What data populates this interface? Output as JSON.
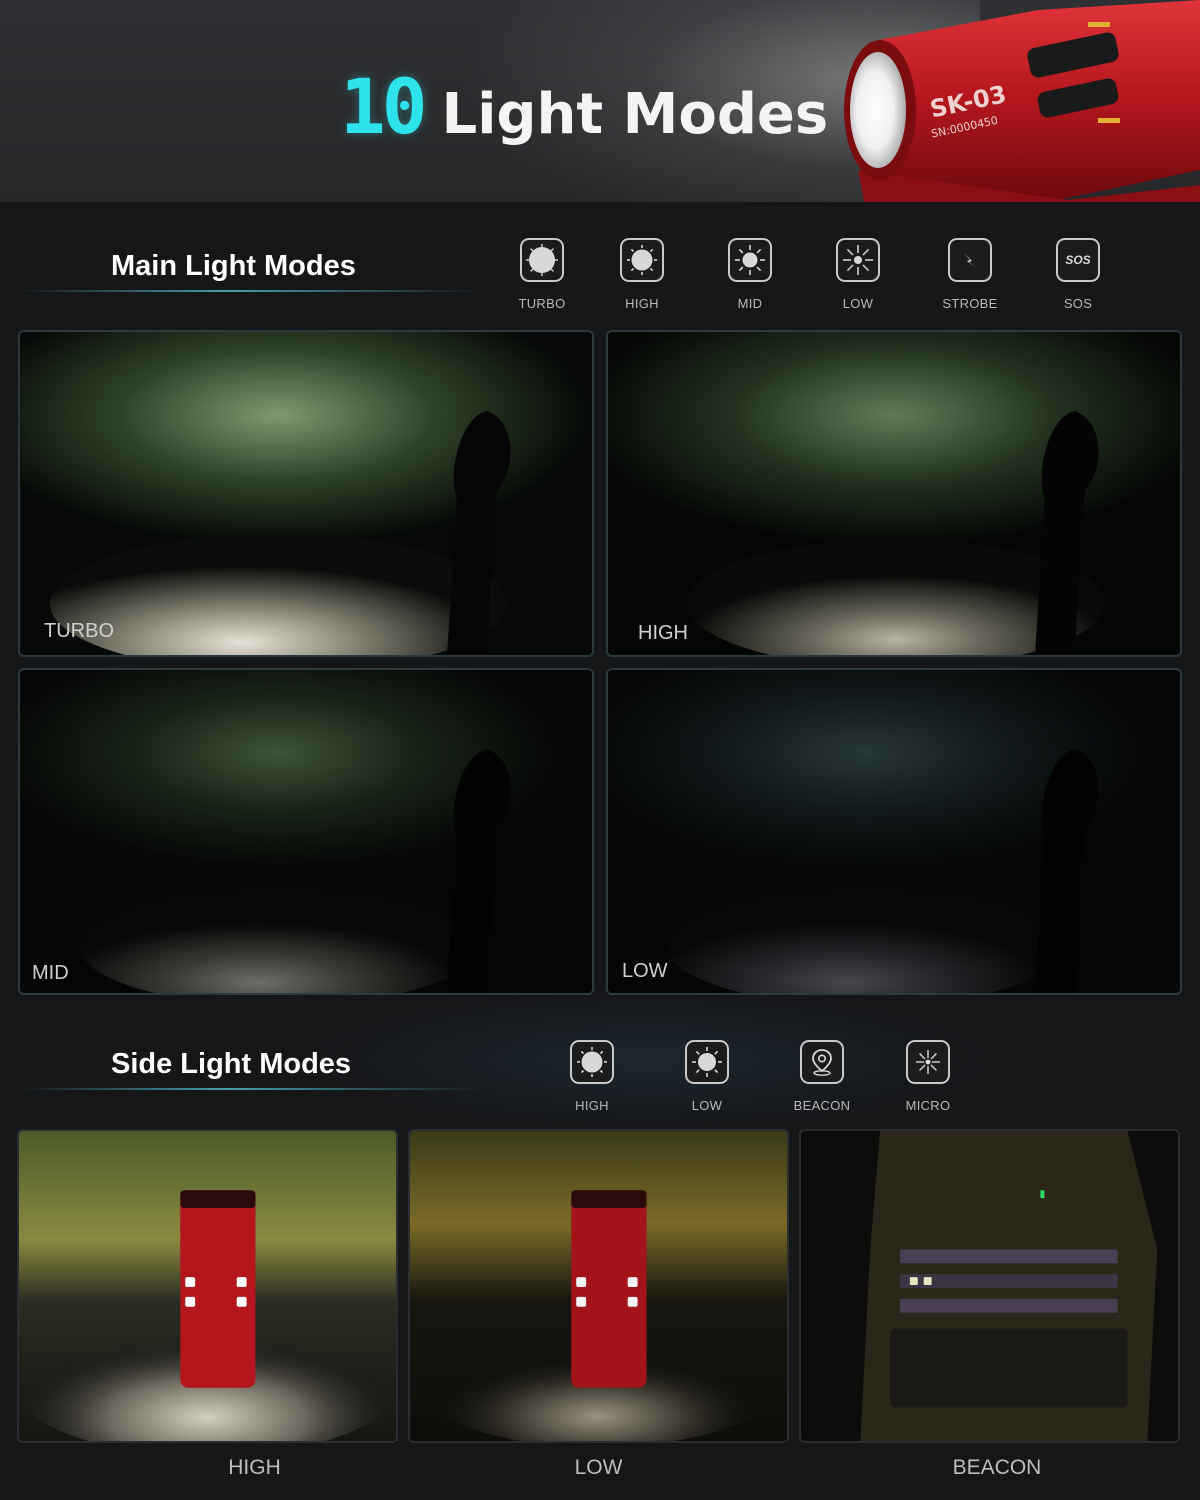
{
  "header": {
    "number": "10",
    "title": "Light Modes",
    "product_model": "SK-03",
    "product_serial": "SN:0000450"
  },
  "main_section": {
    "title": "Main Light Modes",
    "icons": [
      {
        "label": "TURBO",
        "icon": "sun-turbo-icon"
      },
      {
        "label": "HIGH",
        "icon": "sun-high-icon"
      },
      {
        "label": "MID",
        "icon": "sun-mid-icon"
      },
      {
        "label": "LOW",
        "icon": "sun-low-icon"
      },
      {
        "label": "STROBE",
        "icon": "lightning-icon"
      },
      {
        "label": "SOS",
        "icon": "sos-icon",
        "icon_text": "SOS"
      }
    ],
    "photos": [
      {
        "label": "TURBO",
        "brightness": 1.0
      },
      {
        "label": "HIGH",
        "brightness": 0.75
      },
      {
        "label": "MID",
        "brightness": 0.5
      },
      {
        "label": "LOW",
        "brightness": 0.3
      }
    ]
  },
  "side_section": {
    "title": "Side Light Modes",
    "icons": [
      {
        "label": "HIGH",
        "icon": "sun-high-icon"
      },
      {
        "label": "LOW",
        "icon": "sun-low-icon"
      },
      {
        "label": "BEACON",
        "icon": "location-pin-icon"
      },
      {
        "label": "MICRO",
        "icon": "sun-micro-icon"
      }
    ],
    "photos": [
      {
        "label": "HIGH",
        "brightness": 1.0
      },
      {
        "label": "LOW",
        "brightness": 0.6
      },
      {
        "label": "BEACON",
        "brightness": 0.2
      }
    ]
  },
  "colors": {
    "accent": "#2fe3ea",
    "background": "#151618",
    "header": "#2a2b2e",
    "product_red": "#b3161d"
  }
}
